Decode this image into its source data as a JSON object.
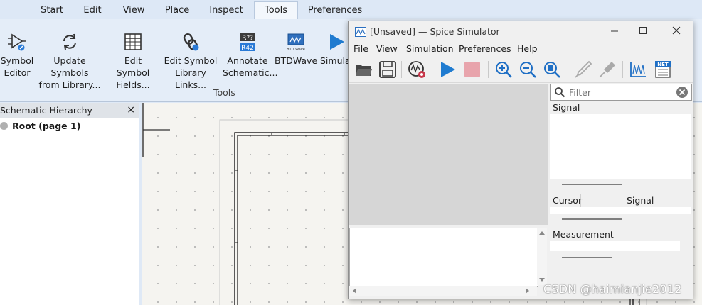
{
  "ribbon": {
    "tabs": [
      {
        "label": "Start"
      },
      {
        "label": "Edit"
      },
      {
        "label": "View"
      },
      {
        "label": "Place"
      },
      {
        "label": "Inspect"
      },
      {
        "label": "Tools"
      },
      {
        "label": "Preferences"
      }
    ],
    "active_tab": "Tools",
    "buttons": [
      {
        "line1": "Symbol",
        "line2": "Editor"
      },
      {
        "line1": "Update Symbols",
        "line2": "from Library..."
      },
      {
        "line1": "Edit Symbol",
        "line2": "Fields..."
      },
      {
        "line1": "Edit Symbol",
        "line2": "Library Links..."
      },
      {
        "line1": "Annotate",
        "line2": "Schematic..."
      },
      {
        "line1": "BTDWave",
        "line2": ""
      },
      {
        "line1": "Simula",
        "line2": ""
      }
    ],
    "annotate_icon_top": "R??",
    "annotate_icon_bottom": "R42",
    "btdwave_icon_text": "BTD Wave",
    "group_label": "Tools"
  },
  "hierarchy": {
    "title": "Schematic Hierarchy",
    "close_glyph": "×",
    "root_label": "Root (page 1)"
  },
  "spice": {
    "title": "[Unsaved] — Spice Simulator",
    "menu": [
      "File",
      "View",
      "Simulation",
      "Preferences",
      "Help"
    ],
    "filter_placeholder": "Filter",
    "signal_header": "Signal",
    "cursor_header": "Cursor",
    "cursor_signal_header": "Signal",
    "measurement_header": "Measurement",
    "net_icon_text": "NET"
  },
  "watermark": "CSDN @haimianjie2012",
  "colors": {
    "ribbon_bg": "#e4edf8",
    "run_button": "#1f7bd0",
    "stop_button": "#e8a4ac",
    "plot_bg": "#d6d6d6"
  }
}
